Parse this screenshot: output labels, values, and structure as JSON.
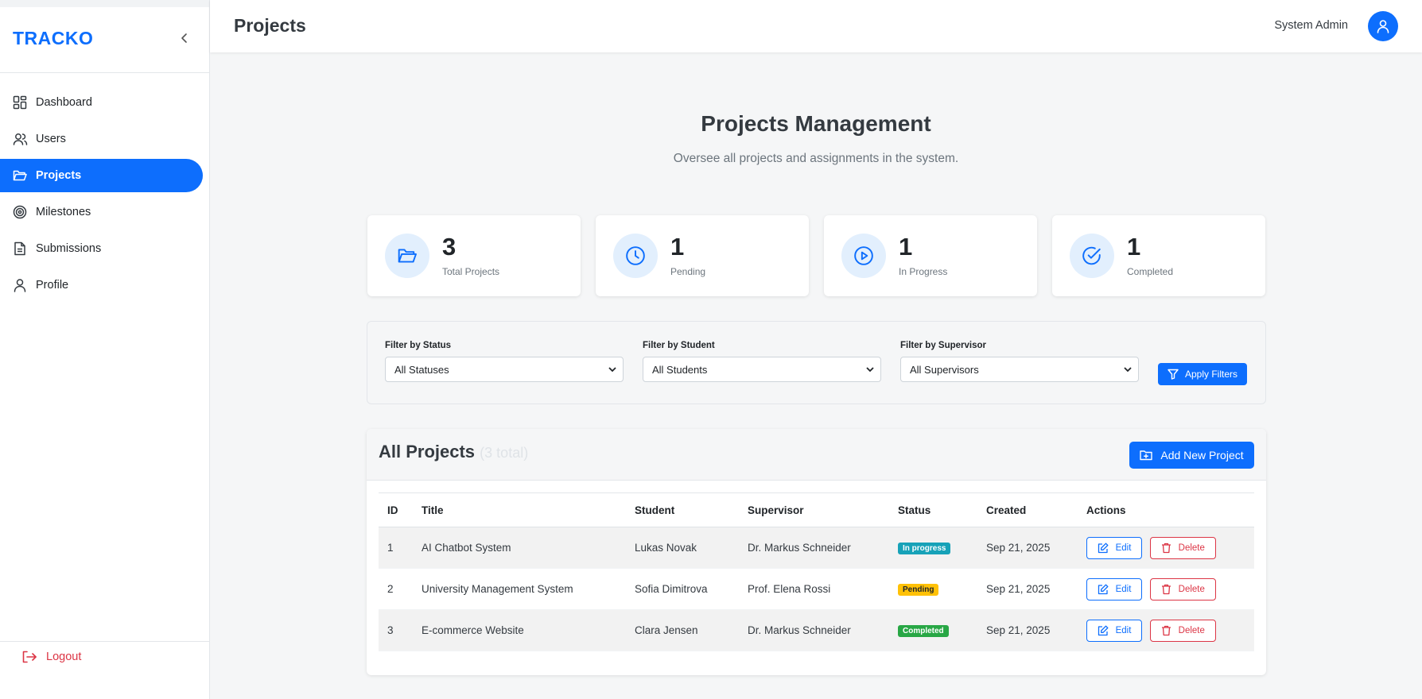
{
  "app": {
    "brand": "TRACKO"
  },
  "sidebar": {
    "items": [
      {
        "label": "Dashboard",
        "icon": "dashboard-icon"
      },
      {
        "label": "Users",
        "icon": "users-icon"
      },
      {
        "label": "Projects",
        "icon": "folder-icon"
      },
      {
        "label": "Milestones",
        "icon": "target-icon"
      },
      {
        "label": "Submissions",
        "icon": "file-icon"
      },
      {
        "label": "Profile",
        "icon": "user-icon"
      }
    ],
    "active": "Projects",
    "logout_label": "Logout"
  },
  "topbar": {
    "title": "Projects",
    "user_name": "System Admin"
  },
  "main": {
    "heading": "Projects Management",
    "subheading": "Oversee all projects and assignments in the system."
  },
  "stats": [
    {
      "value": "3",
      "label": "Total Projects",
      "icon": "folder-icon"
    },
    {
      "value": "1",
      "label": "Pending",
      "icon": "clock-icon"
    },
    {
      "value": "1",
      "label": "In Progress",
      "icon": "play-icon"
    },
    {
      "value": "1",
      "label": "Completed",
      "icon": "check-circle-icon"
    }
  ],
  "filters": {
    "status": {
      "label": "Filter by Status",
      "value": "All Statuses"
    },
    "student": {
      "label": "Filter by Student",
      "value": "All Students"
    },
    "supervisor": {
      "label": "Filter by Supervisor",
      "value": "All Supervisors"
    },
    "apply_label": "Apply Filters"
  },
  "projects": {
    "title": "All Projects",
    "count_text": "(3 total)",
    "add_label": "Add New Project",
    "columns": [
      "ID",
      "Title",
      "Student",
      "Supervisor",
      "Status",
      "Created",
      "Actions"
    ],
    "rows": [
      {
        "id": "1",
        "title": "AI Chatbot System",
        "student": "Lukas Novak",
        "supervisor": "Dr. Markus Schneider",
        "status": "In progress",
        "created": "Sep 21, 2025"
      },
      {
        "id": "2",
        "title": "University Management System",
        "student": "Sofia Dimitrova",
        "supervisor": "Prof. Elena Rossi",
        "status": "Pending",
        "created": "Sep 21, 2025"
      },
      {
        "id": "3",
        "title": "E-commerce Website",
        "student": "Clara Jensen",
        "supervisor": "Dr. Markus Schneider",
        "status": "Completed",
        "created": "Sep 21, 2025"
      }
    ],
    "edit_label": "Edit",
    "delete_label": "Delete"
  },
  "colors": {
    "primary": "#0d6efd",
    "danger": "#dc3545",
    "info": "#17a2b8",
    "warning": "#ffc107",
    "success": "#28a745"
  }
}
